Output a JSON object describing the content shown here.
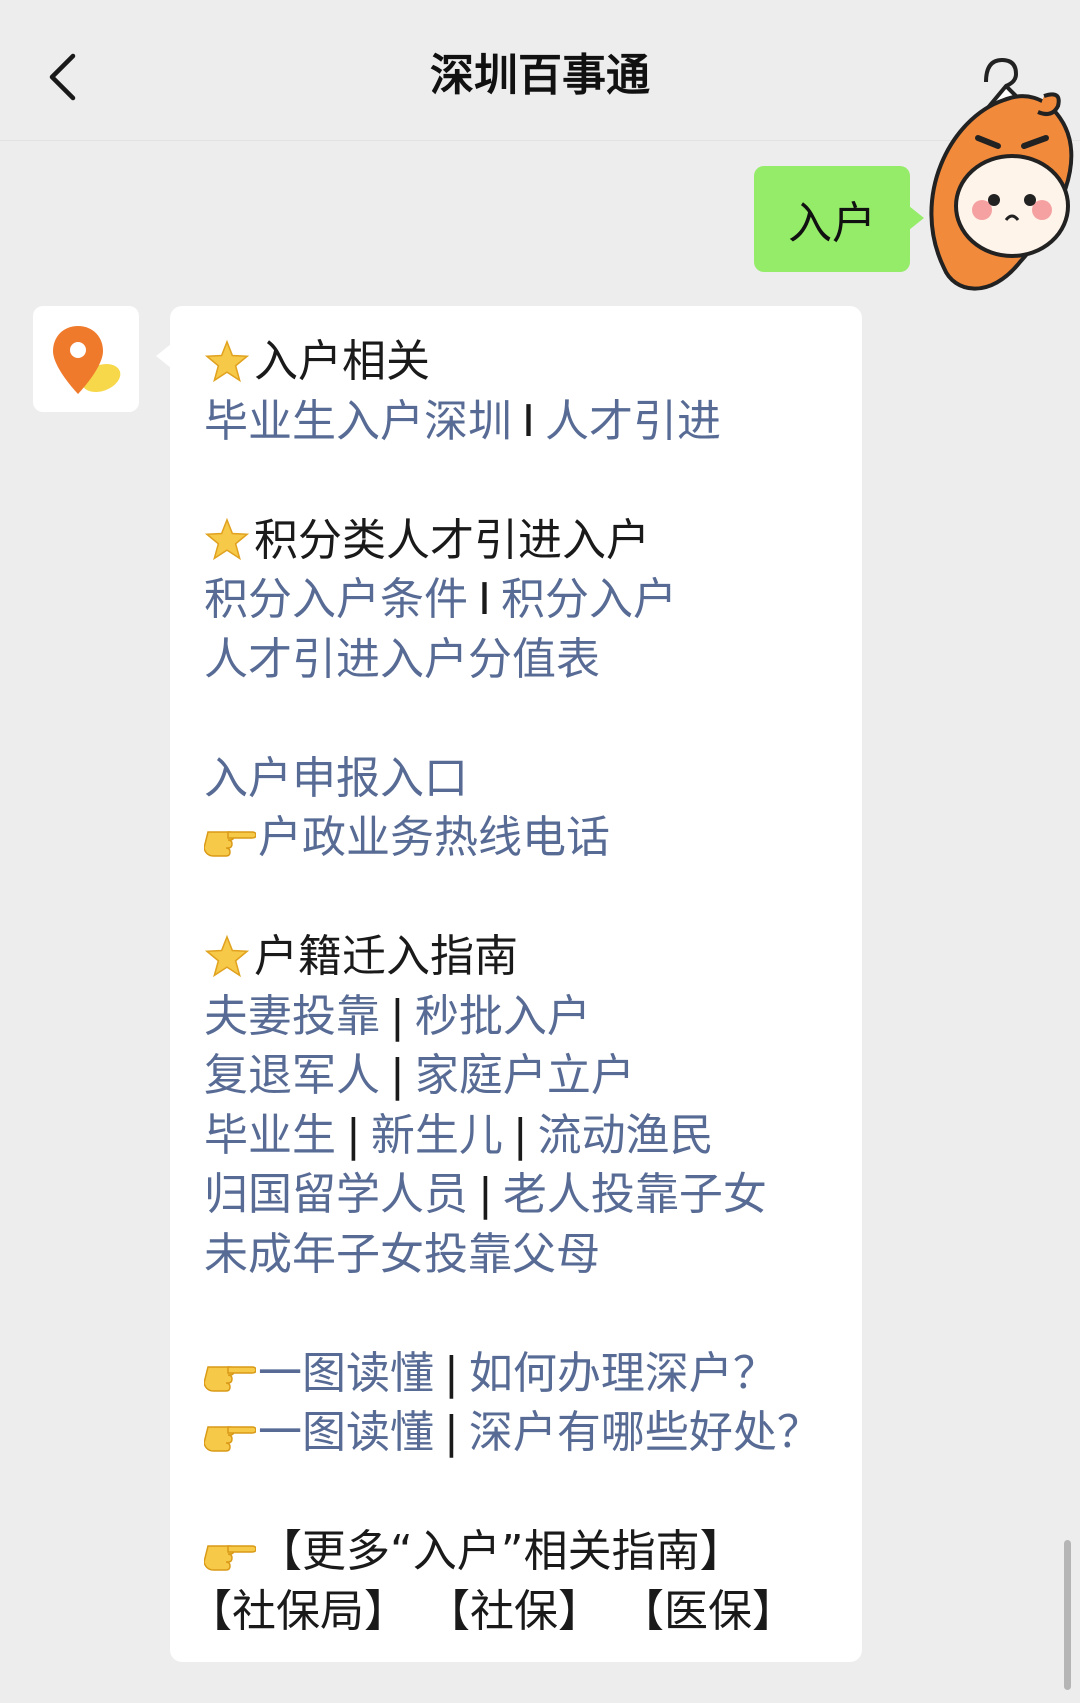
{
  "header": {
    "title": "深圳百事通",
    "back_icon": "chevron-left-icon"
  },
  "chat": {
    "user_message": "入户",
    "bot_message": {
      "section1": {
        "heading": "入户相关",
        "links": [
          "毕业生入户深圳",
          "人才引进"
        ]
      },
      "section2": {
        "heading": "积分类人才引进入户",
        "links": [
          "积分入户条件",
          "积分入户",
          "人才引进入户分值表"
        ]
      },
      "section3": {
        "link1": "入户申报入口",
        "link2": "户政业务热线电话"
      },
      "section4": {
        "heading": "户籍迁入指南",
        "links": [
          "夫妻投靠",
          "秒批入户",
          "复退军人",
          "家庭户立户",
          "毕业生",
          "新生儿",
          "流动渔民",
          "归国留学人员",
          "老人投靠子女",
          "未成年子女投靠父母"
        ]
      },
      "section5": {
        "prefix": "一图读懂",
        "items": [
          "如何办理深户？",
          "深户有哪些好处？"
        ]
      },
      "section6": {
        "more": "【更多“入户”相关指南】",
        "tags": [
          "【社保局】",
          "【社保】",
          "【医保】"
        ]
      },
      "separators": {
        "thin": "I",
        "pipe": "|"
      }
    }
  },
  "colors": {
    "background": "#ededed",
    "user_bubble": "#95ec69",
    "bot_bubble": "#ffffff",
    "link": "#576b95",
    "accent_orange": "#f28a3c"
  },
  "icons": {
    "star": "star-emoji-icon",
    "hand": "pointing-hand-emoji-icon",
    "bot_avatar": "map-pin-logo-icon",
    "user_avatar": "cartoon-character-avatar"
  }
}
